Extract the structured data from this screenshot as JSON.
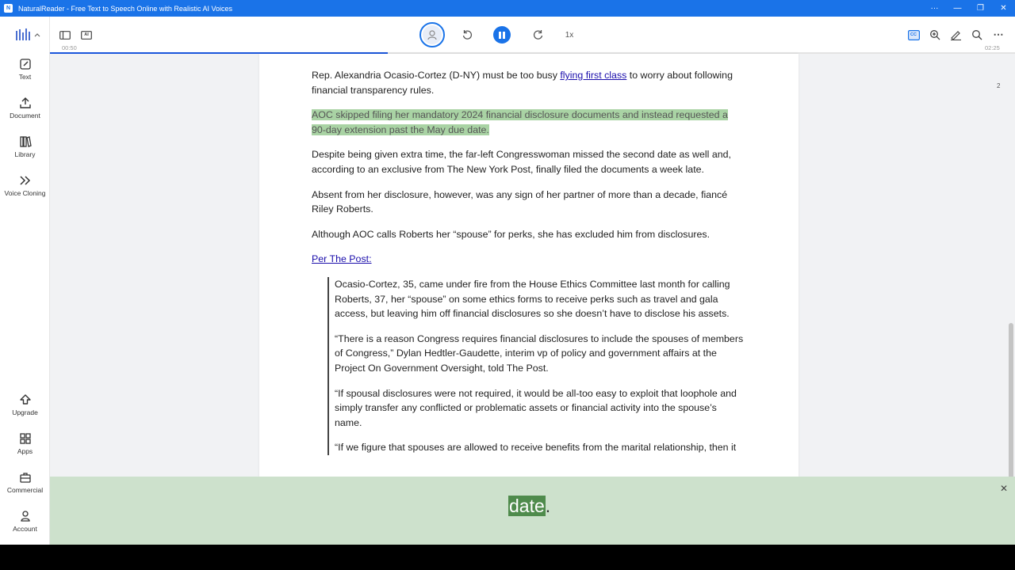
{
  "window": {
    "title": "NaturalReader - Free Text to Speech Online with Realistic AI Voices",
    "icon_letter": "N",
    "controls": [
      "···",
      "—",
      "❐",
      "✕"
    ]
  },
  "sidebar": {
    "items": [
      {
        "label": "Text",
        "icon": "pencil-icon"
      },
      {
        "label": "Document",
        "icon": "upload-icon"
      },
      {
        "label": "Library",
        "icon": "library-icon"
      },
      {
        "label": "Voice Cloning",
        "icon": "voice-cloning-icon"
      },
      {
        "label": "Upgrade",
        "icon": "upgrade-arrow-icon"
      },
      {
        "label": "Apps",
        "icon": "apps-grid-icon"
      },
      {
        "label": "Commercial",
        "icon": "briefcase-icon"
      },
      {
        "label": "Account",
        "icon": "person-icon"
      }
    ]
  },
  "player": {
    "elapsed": "00:50",
    "total": "02:25",
    "speed": "1x",
    "progress_fraction": 0.35,
    "ai_badge": "AI",
    "cc_badge": "CC"
  },
  "document": {
    "page_number": "2",
    "p1_before": "Rep. Alexandria Ocasio-Cortez (D-NY) must be too busy ",
    "p1_link": "flying first class",
    "p1_after": " to worry about following financial transparency rules.",
    "p2_highlight": "AOC skipped filing her mandatory 2024 financial disclosure documents and instead requested a 90-day extension past the May due date.",
    "p3": "Despite being given extra time, the far-left Congresswoman missed the second date as well and, according to an exclusive from The New York Post, finally filed the documents a week late.",
    "p4": "Absent from her disclosure, however, was any sign of her partner of more than a decade, fiancé Riley Roberts.",
    "p5": "Although AOC calls Roberts her “spouse” for perks, she has excluded him from disclosures.",
    "p6_link": "Per The Post:",
    "q1": "Ocasio-Cortez, 35, came under fire from the House Ethics Committee last month for calling Roberts, 37, her “spouse” on some ethics forms to receive perks such as travel and gala access, but leaving him off financial disclosures so she doesn’t have to disclose his assets.",
    "q2": "“There is a reason Congress requires financial disclosures to include the spouses of members of Congress,” Dylan Hedtler-Gaudette, interim vp of policy and government affairs at the Project On Government Oversight, told The Post.",
    "q3": "“If spousal disclosures were not required, it would be all-too easy to exploit that loophole and simply transfer any conflicted or problematic assets or financial activity into the spouse’s name.",
    "q4_partial": "“If we figure that spouses are allowed to receive benefits from the marital relationship, then it"
  },
  "caption": {
    "word": "date",
    "punct": ".",
    "close": "✕"
  },
  "colors": {
    "accent": "#1a73e8",
    "highlight": "#a9d3a4",
    "caption_bg": "#cde1cc",
    "caption_word_bg": "#4f8b4c"
  }
}
